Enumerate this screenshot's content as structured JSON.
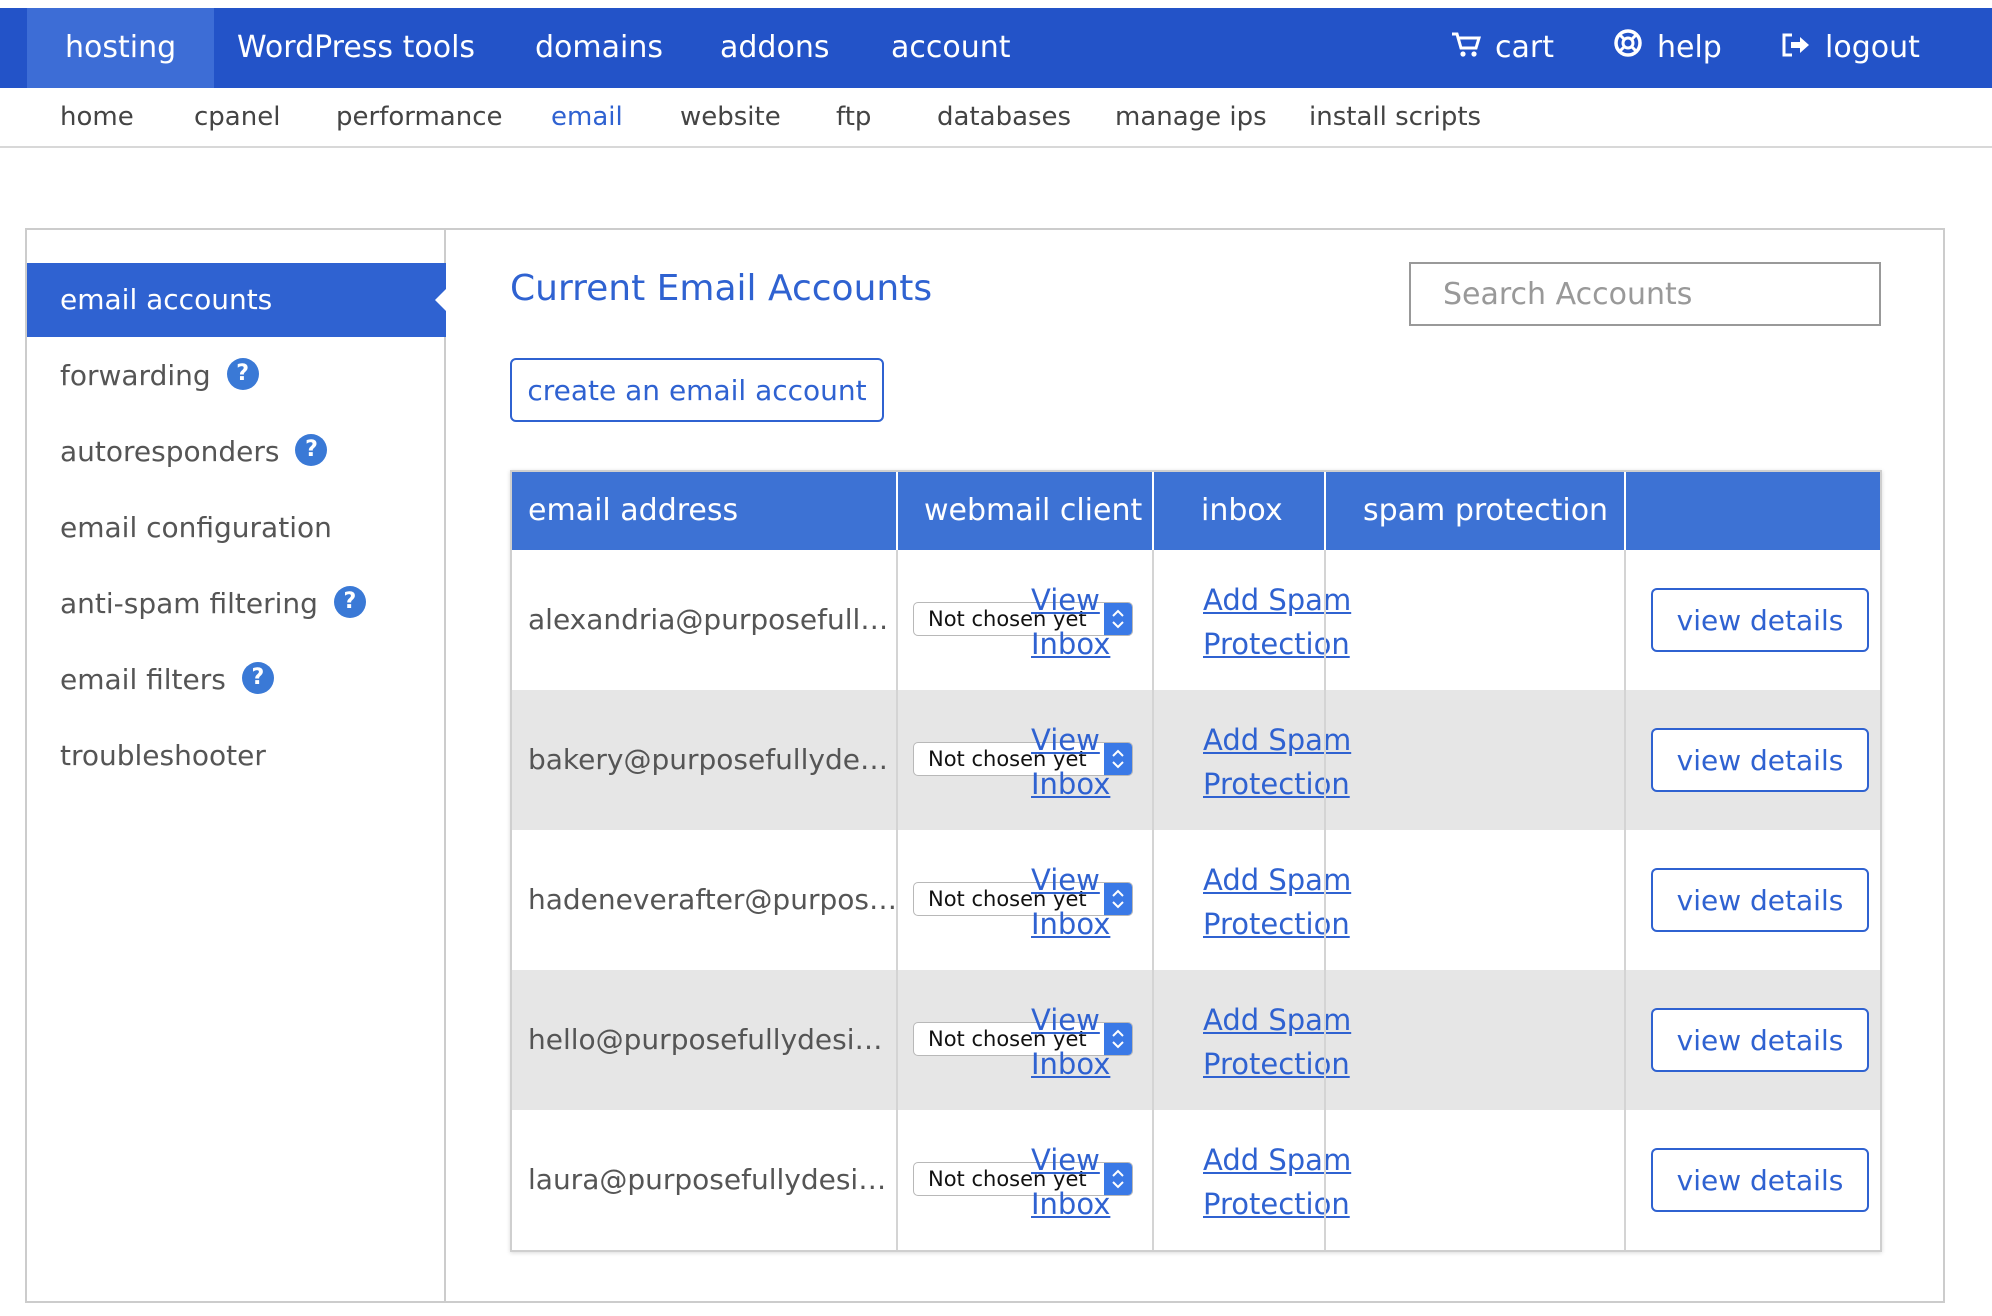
{
  "topnav": {
    "items": [
      "hosting",
      "WordPress tools",
      "domains",
      "addons",
      "account"
    ],
    "right": [
      {
        "label": "cart",
        "icon": "cart-icon"
      },
      {
        "label": "help",
        "icon": "lifebuoy-icon"
      },
      {
        "label": "logout",
        "icon": "logout-icon"
      }
    ],
    "active": "hosting",
    "color": "#2353c8"
  },
  "subnav": {
    "items": [
      "home",
      "cpanel",
      "performance",
      "email",
      "website",
      "ftp",
      "databases",
      "manage ips",
      "install scripts"
    ],
    "active": "email"
  },
  "sidebar": {
    "items": [
      {
        "label": "email accounts",
        "help": false,
        "active": true
      },
      {
        "label": "forwarding",
        "help": true
      },
      {
        "label": "autoresponders",
        "help": true
      },
      {
        "label": "email configuration",
        "help": false
      },
      {
        "label": "anti-spam filtering",
        "help": true
      },
      {
        "label": "email filters",
        "help": true
      },
      {
        "label": "troubleshooter",
        "help": false
      }
    ],
    "help_glyph": "?"
  },
  "main": {
    "title": "Current Email Accounts",
    "search_placeholder": "Search Accounts",
    "create_button": "create an email account"
  },
  "table": {
    "headers": [
      "email address",
      "webmail client",
      "inbox",
      "spam protection",
      ""
    ],
    "rows": [
      {
        "email": "alexandria@purposefull…",
        "webmail": "Not chosen yet",
        "inbox": [
          "View",
          "Inbox"
        ],
        "spam": [
          "Add Spam",
          "Protection"
        ],
        "action": "view details"
      },
      {
        "email": "bakery@purposefullyde…",
        "webmail": "Not chosen yet",
        "inbox": [
          "View",
          "Inbox"
        ],
        "spam": [
          "Add Spam",
          "Protection"
        ],
        "action": "view details"
      },
      {
        "email": "hadeneverafter@purpos…",
        "webmail": "Not chosen yet",
        "inbox": [
          "View",
          "Inbox"
        ],
        "spam": [
          "Add Spam",
          "Protection"
        ],
        "action": "view details"
      },
      {
        "email": "hello@purposefullydesig…",
        "webmail": "Not chosen yet",
        "inbox": [
          "View",
          "Inbox"
        ],
        "spam": [
          "Add Spam",
          "Protection"
        ],
        "action": "view details"
      },
      {
        "email": "laura@purposefullydesig…",
        "webmail": "Not chosen yet",
        "inbox": [
          "View",
          "Inbox"
        ],
        "spam": [
          "Add Spam",
          "Protection"
        ],
        "action": "view details"
      }
    ]
  },
  "colors": {
    "accent": "#2f62d1",
    "header": "#3d72d4",
    "alt_row": "#e6e6e6"
  }
}
